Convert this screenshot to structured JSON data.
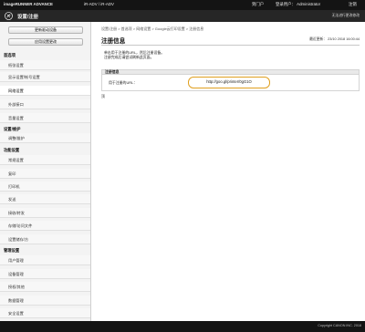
{
  "topbar": {
    "model": "imageRUNNER ADVANCE",
    "device_name": "iR-ADV / iR-ADV",
    "portal_link": "到门户",
    "login_user": "登录用户： Administrator",
    "logout": "注销"
  },
  "titlebar": {
    "title": "设置/注册",
    "note": "无法进行更改修改"
  },
  "sidebar": {
    "buttons": [
      "更新驱动设备",
      "应用设置更改"
    ],
    "sections": {
      "preferences": "首选项",
      "management": "设置/维护",
      "function": "功能设置",
      "admin": "管理设置"
    },
    "items": {
      "paper": "纸张设置",
      "display": "显示设置/帐号设置",
      "network": "网络设置",
      "external_iface": "外部接口",
      "volume": "音量设置",
      "maintenance": "调整/维护",
      "common": "常规设置",
      "copy": "复印",
      "printer": "打印机",
      "send": "发送",
      "receive": "接收/转发",
      "store": "存储/访问文件",
      "device_mgmt": "设置储存/方",
      "user_mgmt": "用户管理",
      "device_admin": "设备管理",
      "license": "授权/其他",
      "data_mgmt": "数据管理",
      "security": "安全设置"
    }
  },
  "content": {
    "breadcrumb": "设置/注册 > 首选项 > 网络设置 > Google云打印设置 > 注册信息",
    "title": "注册信息",
    "updated": "最近更新： 23/10 2018 16:00:44",
    "intro_line1": "单击用于注册的URL，然后注册设备。",
    "intro_line2": "注册完成后请尝试刷新此页面。",
    "info_header": "注册信息",
    "url_label": "用于注册的URL：",
    "url_value": "http://goo.gl/printer/0gG1O",
    "top_link": "顶"
  },
  "footer": {
    "copyright": "Copyright CANON INC. 2018"
  }
}
